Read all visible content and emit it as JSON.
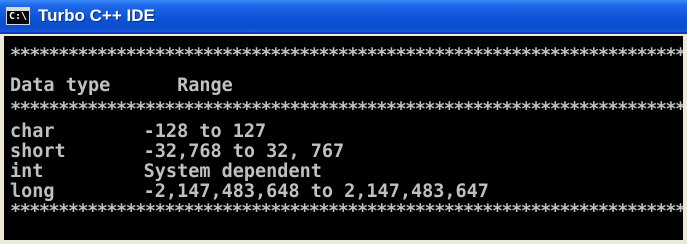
{
  "window": {
    "title": "Turbo C++ IDE",
    "icon": "console-icon",
    "icon_text": "C:\\"
  },
  "console": {
    "separator": "**********************************************************************",
    "header_line": "Data type      Range",
    "rows": [
      "char        -128 to 127",
      "short       -32,768 to 32, 767",
      "int         System dependent",
      "long        -2,147,483,648 to 2,147,483,647"
    ]
  }
}
